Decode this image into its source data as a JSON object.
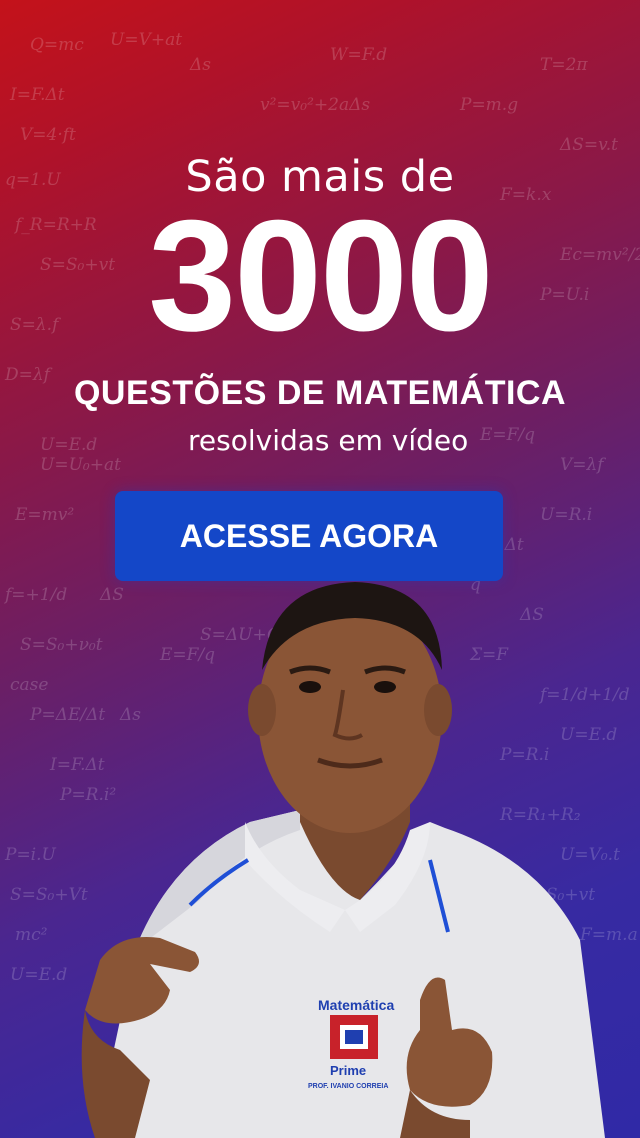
{
  "headline": {
    "line1": "São mais de",
    "number": "3000",
    "line2": "QUESTÕES DE MATEMÁTICA",
    "line3": "resolvidas em vídeo"
  },
  "cta": {
    "label": "ACESSE AGORA"
  },
  "shirt_logo": {
    "line1": "Matemática",
    "line2": "Prime",
    "line3": "PROF. IVANIO CORREIA"
  },
  "colors": {
    "top": "#c4121a",
    "bottom": "#3029a6",
    "button": "#1447c8"
  },
  "icons": [
    "formula-background-pattern",
    "teacher-photo",
    "shirt-logo-icon"
  ]
}
